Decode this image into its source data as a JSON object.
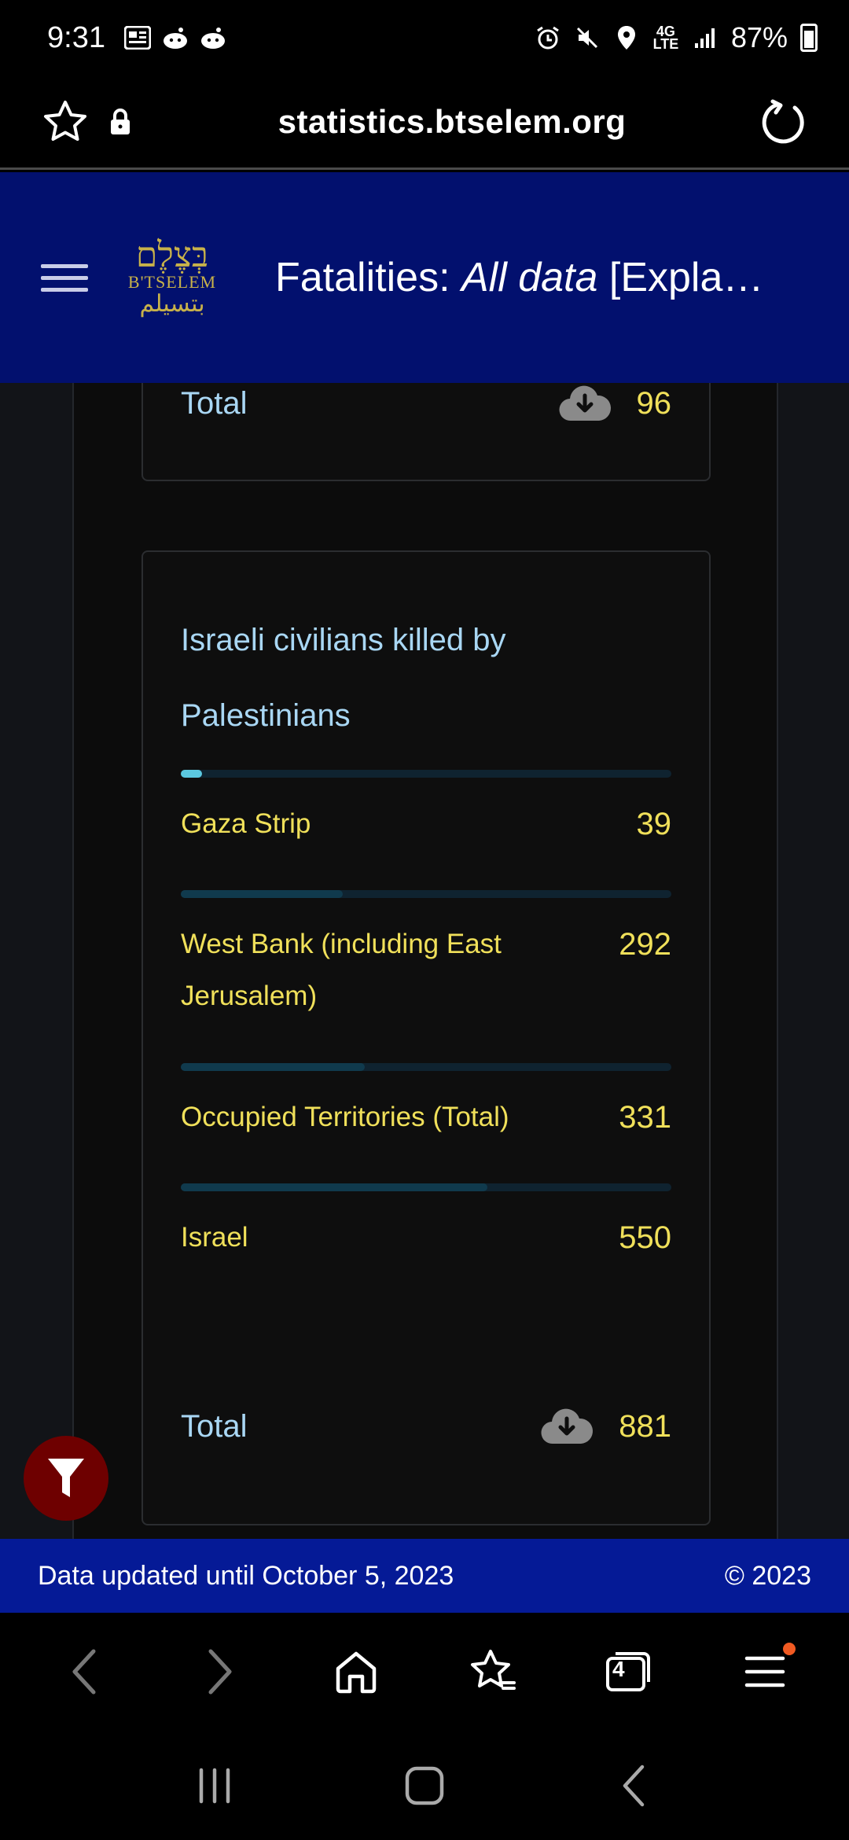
{
  "status_bar": {
    "time": "9:31",
    "battery": "87%",
    "network": "4G LTE"
  },
  "browser": {
    "url": "statistics.btselem.org"
  },
  "site_header": {
    "title_prefix": "Fatalities: ",
    "title_italic": "All data",
    "title_suffix": " [Expla…",
    "logo": {
      "hebrew": "בְּצֶלֶם",
      "latin": "B'TSELEM",
      "arabic": "بتسيلم"
    }
  },
  "previous_card": {
    "total_label": "Total",
    "total_value": "96"
  },
  "card": {
    "title": "Israeli civilians killed by Palestinians",
    "stats": [
      {
        "label": "Gaza Strip",
        "value": "39",
        "fraction": 0.044,
        "color": "#5bc8e0"
      },
      {
        "label": "West Bank (including East Jerusalem)",
        "value": "292",
        "fraction": 0.33,
        "color": "#103a4d"
      },
      {
        "label": "Occupied Territories (Total)",
        "value": "331",
        "fraction": 0.375,
        "color": "#103a4d"
      },
      {
        "label": "Israel",
        "value": "550",
        "fraction": 0.625,
        "color": "#103a4d"
      }
    ],
    "total_label": "Total",
    "total_value": "881"
  },
  "footer": {
    "updated": "Data updated until October 5, 2023",
    "copyright": "© 2023"
  },
  "browser_nav": {
    "tab_count": "4"
  },
  "colors": {
    "header_bg": "#02106e",
    "footer_bg": "#051a96",
    "accent_yellow": "#f0e05a",
    "accent_blue_text": "#a9d7f4",
    "fab_bg": "#6e0000"
  }
}
